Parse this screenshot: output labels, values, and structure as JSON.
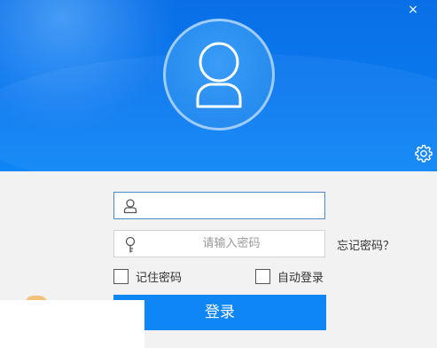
{
  "window": {
    "close_label": "×"
  },
  "header": {
    "avatar_icon": "user-avatar-icon",
    "settings_icon": "gear-icon",
    "colors": {
      "top": "#0a6fe6",
      "bottom": "#0d86f7"
    }
  },
  "form": {
    "username": {
      "icon": "user-icon",
      "value": "",
      "placeholder": ""
    },
    "password": {
      "icon": "key-icon",
      "value": "",
      "placeholder": "请输入密码"
    },
    "forgot_password": "忘记密码？",
    "remember_password": {
      "label": "记住密码",
      "checked": false
    },
    "auto_login": {
      "label": "自动登录",
      "checked": false
    },
    "login_button": "登录",
    "accent_color": "#0f86f5"
  }
}
